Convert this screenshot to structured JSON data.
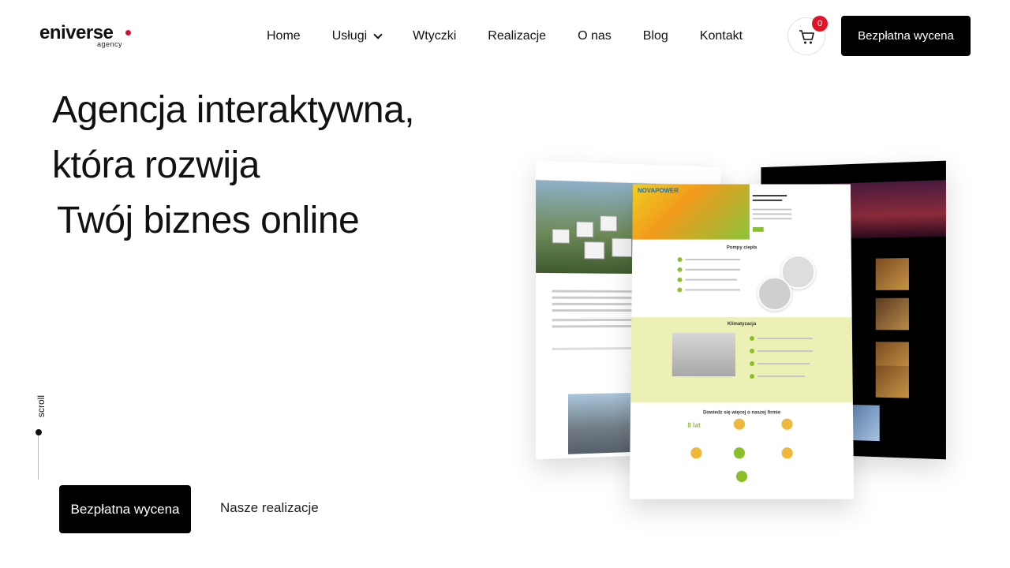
{
  "header": {
    "logo_word": "eniverse",
    "logo_sub": "agency",
    "nav": [
      "Home",
      "Usługi",
      "Wtyczki",
      "Realizacje",
      "O nas",
      "Blog",
      "Kontakt"
    ],
    "cart_count": "0",
    "cta_label": "Bezpłatna wycena"
  },
  "hero": {
    "line1": "Agencja interaktywna,",
    "line2": "która rozwija",
    "line3": "Twój biznes  online"
  },
  "scroll_label": "scroll",
  "actions": {
    "primary_label": "Bezpłatna wycena",
    "secondary_label": "Nasze realizacje"
  },
  "showcase": {
    "center_logo": "NOVAPOWER",
    "center_section1": "Pompy ciepła",
    "center_section2": "Klimatyzacja",
    "center_section3": "Dowiedz się więcej o naszej firmie",
    "center_stat": "8 lat"
  },
  "colors": {
    "accent_red": "#d8112e",
    "button_black": "#000000",
    "nova_green": "#8bbf2a",
    "nova_yellow": "#f0d020"
  }
}
